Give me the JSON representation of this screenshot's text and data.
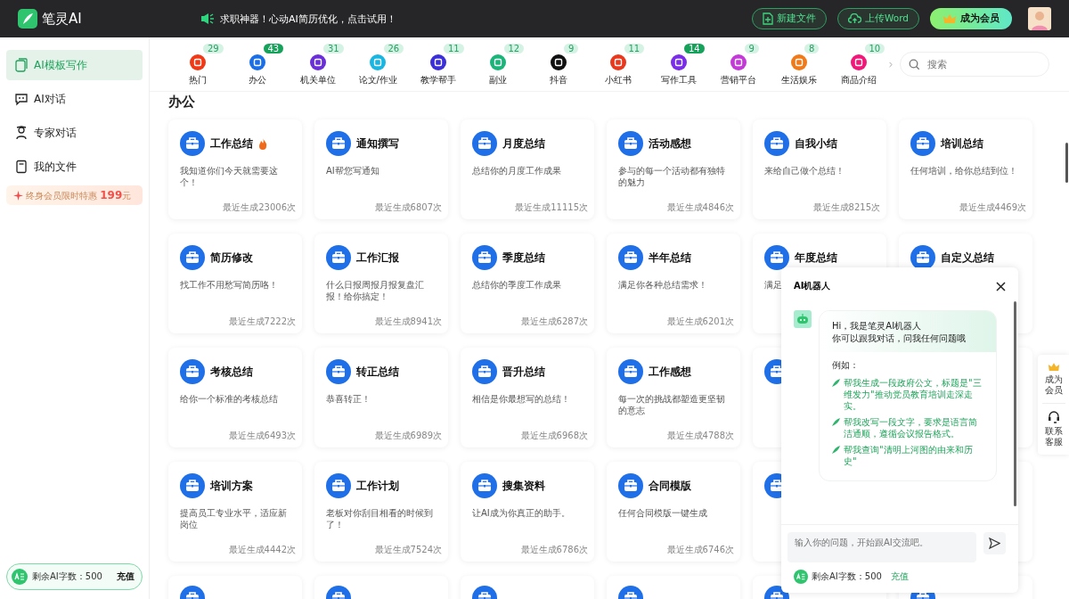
{
  "header": {
    "logo": "笔灵AI",
    "notice": "求职神器！心动AI简历优化，点击试用！",
    "buttons": [
      {
        "label": "新建文件",
        "kind": "file"
      },
      {
        "label": "上传Word",
        "kind": "upload"
      },
      {
        "label": "成为会员",
        "kind": "vip"
      }
    ]
  },
  "sidebar": {
    "items": [
      {
        "label": "AI模板写作",
        "selected": true,
        "kind": "template"
      },
      {
        "label": "AI对话",
        "selected": false,
        "kind": "chat"
      },
      {
        "label": "专家对话",
        "selected": false,
        "kind": "expert"
      },
      {
        "label": "我的文件",
        "selected": false,
        "kind": "file"
      }
    ],
    "promo": "终身会员限时特惠 **199**元",
    "quota": {
      "label": "剩余AI字数：500",
      "action": "充值"
    }
  },
  "categories": [
    {
      "label": "热门",
      "count": "29",
      "highlighted": false,
      "color": "#f03a17"
    },
    {
      "label": "办公",
      "count": "43",
      "highlighted": true,
      "color": "#1a6fe8"
    },
    {
      "label": "机关单位",
      "count": "31",
      "highlighted": false,
      "color": "#6a2fd8"
    },
    {
      "label": "论文/作业",
      "count": "26",
      "highlighted": false,
      "color": "#18b6e0"
    },
    {
      "label": "教学帮手",
      "count": "11",
      "highlighted": false,
      "color": "#3b2fd8"
    },
    {
      "label": "副业",
      "count": "12",
      "highlighted": false,
      "color": "#1bb57a"
    },
    {
      "label": "抖音",
      "count": "9",
      "highlighted": false,
      "color": "#111111"
    },
    {
      "label": "小红书",
      "count": "11",
      "highlighted": false,
      "color": "#e8391f"
    },
    {
      "label": "写作工具",
      "count": "14",
      "highlighted": true,
      "color": "#7a2ee8"
    },
    {
      "label": "营销平台",
      "count": "9",
      "highlighted": false,
      "color": "#c43ad8"
    },
    {
      "label": "生活娱乐",
      "count": "8",
      "highlighted": false,
      "color": "#f07a1a"
    },
    {
      "label": "商品介绍",
      "count": "10",
      "highlighted": false,
      "color": "#f0197a"
    }
  ],
  "search": {
    "placeholder": "搜索"
  },
  "section_title": "办公",
  "cards": [
    {
      "title": "工作总结",
      "hot": true,
      "description": "我知道你们今天就需要这个！",
      "usage": "最近生成23006次"
    },
    {
      "title": "通知撰写",
      "hot": false,
      "description": "AI帮您写通知",
      "usage": "最近生成6807次"
    },
    {
      "title": "月度总结",
      "hot": false,
      "description": "总结你的月度工作成果",
      "usage": "最近生成11115次"
    },
    {
      "title": "活动感想",
      "hot": false,
      "description": "参与的每一个活动都有独特的魅力",
      "usage": "最近生成4846次"
    },
    {
      "title": "自我小结",
      "hot": false,
      "description": "来给自己做个总结！",
      "usage": "最近生成8215次"
    },
    {
      "title": "培训总结",
      "hot": false,
      "description": "任何培训，给你总结到位！",
      "usage": "最近生成4469次"
    },
    {
      "title": "简历修改",
      "hot": false,
      "description": "找工作不用愁写简历咯！",
      "usage": "最近生成7222次"
    },
    {
      "title": "工作汇报",
      "hot": false,
      "description": "什么日报周报月报复盘汇报！给你搞定！",
      "usage": "最近生成8941次"
    },
    {
      "title": "季度总结",
      "hot": false,
      "description": "总结你的季度工作成果",
      "usage": "最近生成6287次"
    },
    {
      "title": "半年总结",
      "hot": false,
      "description": "满足你各种总结需求！",
      "usage": "最近生成6201次"
    },
    {
      "title": "年度总结",
      "hot": false,
      "description": "满足"
    },
    {
      "title": "自定义总结",
      "hot": false
    },
    {
      "title": "考核总结",
      "hot": false,
      "description": "给你一个标准的考核总结",
      "usage": "最近生成6493次"
    },
    {
      "title": "转正总结",
      "hot": false,
      "description": "恭喜转正！",
      "usage": "最近生成6989次"
    },
    {
      "title": "晋升总结",
      "hot": false,
      "description": "相信是你最想写的总结！",
      "usage": "最近生成6968次"
    },
    {
      "title": "工作感想",
      "hot": false,
      "description": "每一次的挑战都塑造更坚韧的意志",
      "usage": "最近生成4788次"
    },
    {
      "kind": "covered"
    },
    {
      "kind": "edge"
    },
    {
      "title": "培训方案",
      "hot": false,
      "description": "提高员工专业水平，适应新岗位",
      "usage": "最近生成4442次"
    },
    {
      "title": "工作计划",
      "hot": false,
      "description": "老板对你刮目相看的时候到了！",
      "usage": "最近生成7524次"
    },
    {
      "title": "搜集资料",
      "hot": false,
      "description": "让AI成为你真正的助手。",
      "usage": "最近生成6786次"
    },
    {
      "title": "合同模版",
      "hot": false,
      "description": "任何合同模版一键生成",
      "usage": "最近生成6746次"
    },
    {
      "kind": "covered"
    },
    {
      "kind": "edge"
    },
    {
      "kind": "cut"
    },
    {
      "kind": "cut"
    },
    {
      "kind": "cut"
    },
    {
      "kind": "cut"
    },
    {
      "kind": "cut"
    },
    {
      "kind": "cut"
    }
  ],
  "chat": {
    "title": "AI机器人",
    "greeting": [
      "Hi，我是笔灵AI机器人",
      "你可以跟我对话，问我任何问题哦"
    ],
    "examples_label": "例如：",
    "examples": [
      "帮我生成一段政府公文，标题是\"三维发力\"推动党员教育培训走深走实。",
      "帮我改写一段文字，要求是语言简洁通顺，遵循会议报告格式。",
      "帮我查询\"清明上河图的由来和历史\""
    ],
    "input": {
      "placeholder": "输入你的问题，开始跟AI交流吧。"
    },
    "quota": {
      "label": "剩余AI字数：500",
      "action": "充值"
    }
  },
  "float_menu": [
    {
      "label": "成为会员",
      "kind": "vip"
    },
    {
      "label": "联系客服",
      "kind": "service"
    }
  ]
}
